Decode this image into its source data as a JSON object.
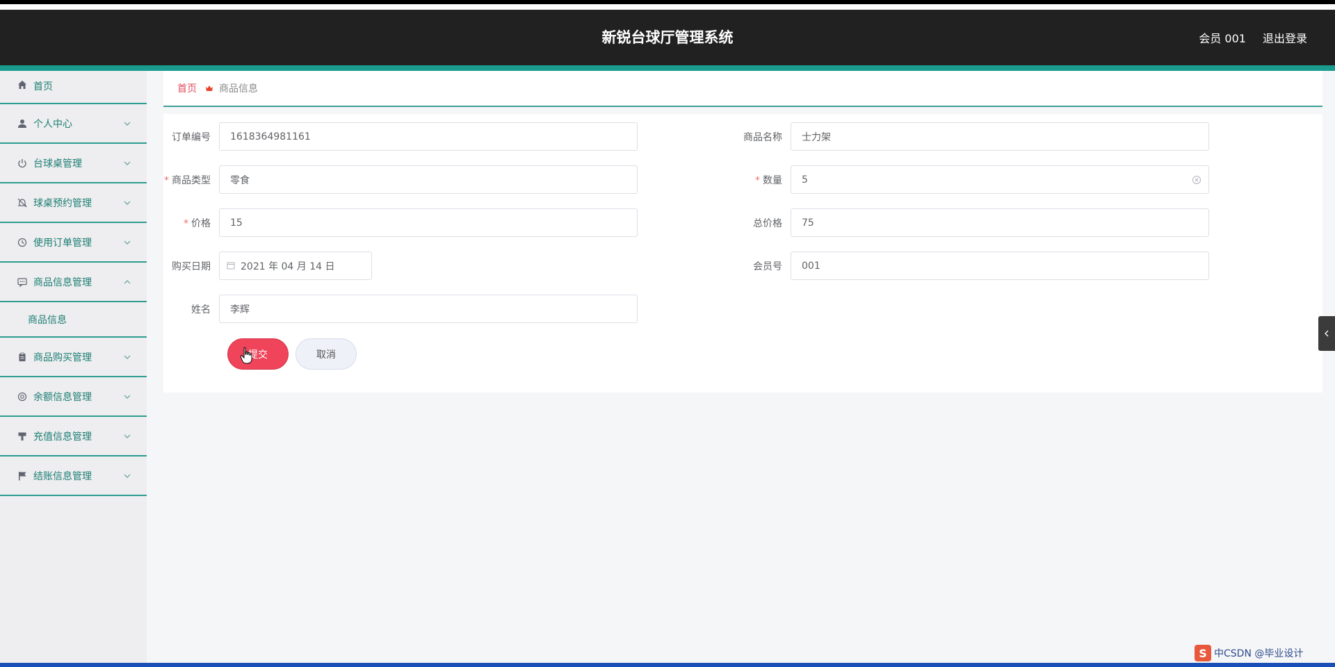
{
  "header": {
    "title": "新锐台球厅管理系统",
    "user_label": "会员 001",
    "logout_label": "退出登录"
  },
  "sidebar": {
    "items": [
      {
        "label": "首页",
        "icon": "home-icon"
      },
      {
        "label": "个人中心",
        "icon": "user-icon"
      },
      {
        "label": "台球桌管理",
        "icon": "power-icon"
      },
      {
        "label": "球桌预约管理",
        "icon": "bell-off-icon"
      },
      {
        "label": "使用订单管理",
        "icon": "clock-icon"
      },
      {
        "label": "商品信息管理",
        "icon": "chat-icon"
      },
      {
        "label": "商品购买管理",
        "icon": "clipboard-icon"
      },
      {
        "label": "余额信息管理",
        "icon": "lifebuoy-icon"
      },
      {
        "label": "充值信息管理",
        "icon": "brush-icon"
      },
      {
        "label": "结账信息管理",
        "icon": "flag-icon"
      }
    ],
    "submenu_label": "商品信息"
  },
  "breadcrumb": {
    "home": "首页",
    "current": "商品信息"
  },
  "form": {
    "order_no": {
      "label": "订单编号",
      "value": "1618364981161"
    },
    "product_name": {
      "label": "商品名称",
      "value": "士力架"
    },
    "product_type": {
      "label": "商品类型",
      "value": "零食"
    },
    "quantity": {
      "label": "数量",
      "value": "5"
    },
    "price": {
      "label": "价格",
      "value": "15"
    },
    "total_price": {
      "label": "总价格",
      "value": "75"
    },
    "purchase_date": {
      "label": "购买日期",
      "value": "2021 年 04 月 14 日"
    },
    "member_no": {
      "label": "会员号",
      "value": "001"
    },
    "name": {
      "label": "姓名",
      "value": "李辉"
    },
    "submit_label": "提交",
    "cancel_label": "取消"
  },
  "ime": {
    "text": "中CSDN @毕业设计"
  },
  "colors": {
    "accent_teal": "#199b8d",
    "header_bg": "#212121",
    "submit_red": "#f0445a"
  }
}
